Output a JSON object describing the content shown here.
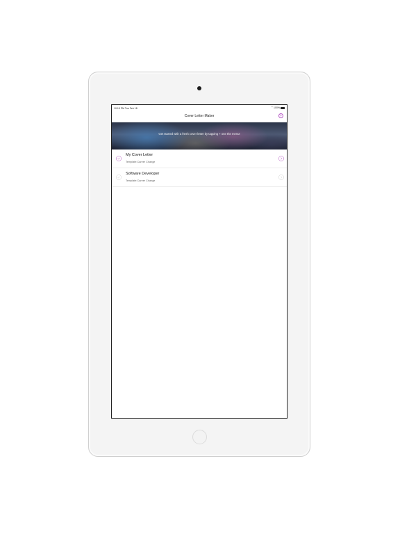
{
  "status_bar": {
    "time": "10:15 PM",
    "date": "Tue Feb 18",
    "wifi": "wifi-icon",
    "battery_percent": "100%"
  },
  "nav": {
    "title": "Cover Letter Maker",
    "add_icon": "plus-circle-icon"
  },
  "banner": {
    "message": "Get started with a fresh cover letter by tapping + one the menu!"
  },
  "list": {
    "items": [
      {
        "title": "My Cover Letter",
        "subtitle": "Template:Career Change",
        "selected": true
      },
      {
        "title": "Software Developer",
        "subtitle": "Template:Career Change",
        "selected": false
      }
    ]
  },
  "colors": {
    "accent": "#b456c4",
    "inactive": "#d0d0d0"
  }
}
